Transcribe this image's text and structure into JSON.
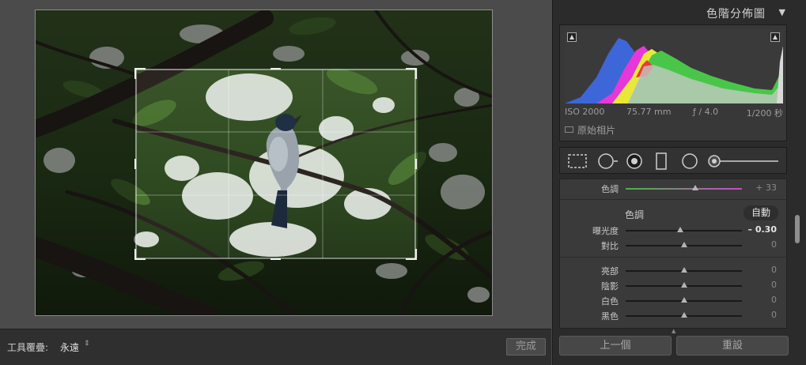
{
  "panel": {
    "title": "色階分佈圖",
    "toggle_icon": "triangle-down-icon"
  },
  "histogram": {
    "iso": "ISO 2000",
    "focal_length": "75.77 mm",
    "aperture": "ƒ / 4.0",
    "shutter": "1/200 秒",
    "original_photo_label": "原始相片"
  },
  "tools": [
    "crop-tool-icon",
    "spot-removal-icon",
    "red-eye-icon",
    "graduated-filter-icon",
    "radial-filter-icon",
    "adjustment-brush-icon"
  ],
  "adjust": {
    "tint": {
      "label": "色調",
      "value": "+ 33",
      "level": 0.6
    },
    "tone_title": "色調",
    "auto_label": "自動",
    "exposure": {
      "label": "曝光度",
      "value": "– 0.30",
      "level": 0.47
    },
    "contrast": {
      "label": "對比",
      "value": "0",
      "level": 0.5
    },
    "highlights": {
      "label": "亮部",
      "value": "0",
      "level": 0.5
    },
    "shadows": {
      "label": "陰影",
      "value": "0",
      "level": 0.5
    },
    "whites": {
      "label": "白色",
      "value": "0",
      "level": 0.5
    },
    "blacks": {
      "label": "黑色",
      "value": "0",
      "level": 0.5
    }
  },
  "footer": {
    "overlay_label": "工具覆疊:",
    "overlay_value": "永遠",
    "done_label": "完成",
    "prev_label": "上一個",
    "reset_label": "重設"
  },
  "colors": {
    "background": "#4a4a4a",
    "panel": "#2b2b2b",
    "tint_green": "#4fb04f",
    "tint_magenta": "#c24fc2",
    "hist_blue": "#3d66d9",
    "hist_magenta": "#e637d8",
    "hist_yellow": "#e8e83b",
    "hist_green": "#49c649",
    "hist_red": "#e33c3c"
  }
}
